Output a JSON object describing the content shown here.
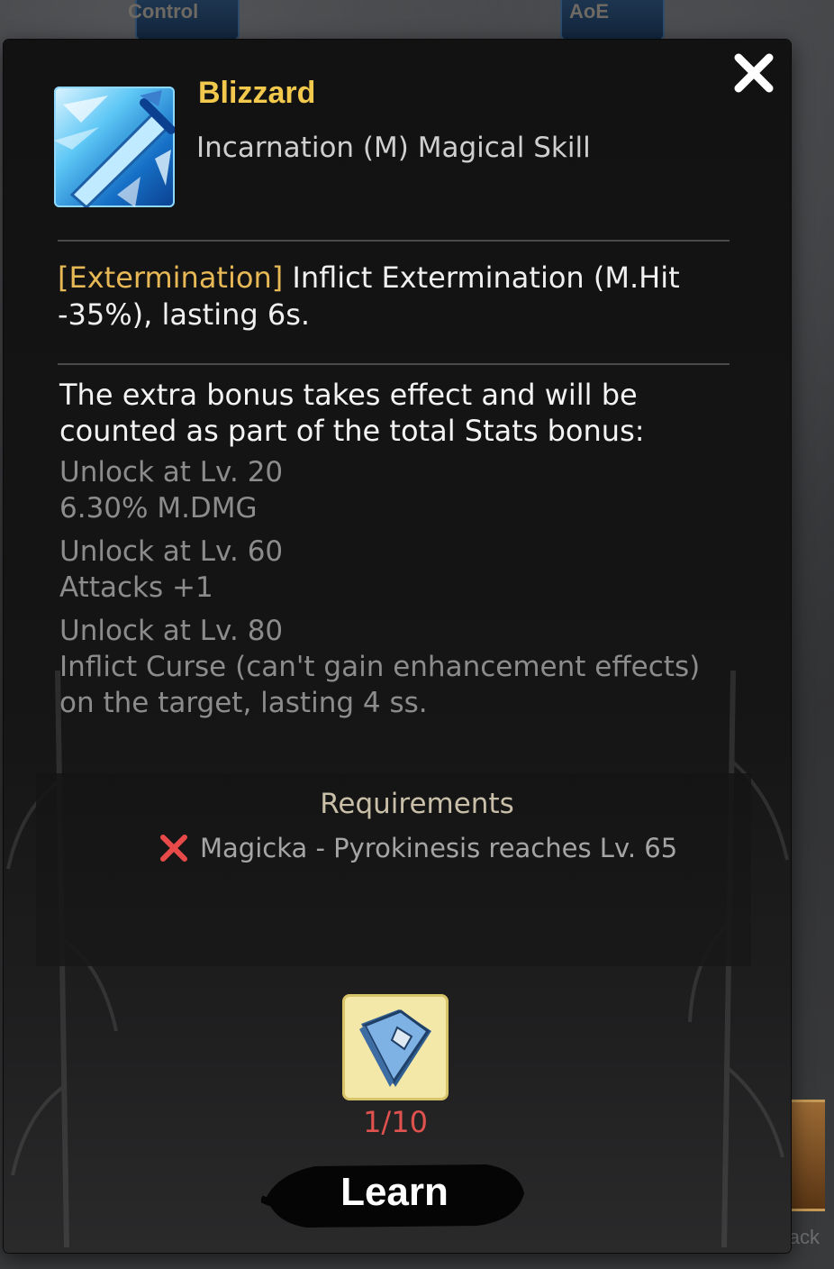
{
  "background": {
    "tabs": [
      "Control",
      "AoE"
    ],
    "right_text": "ack"
  },
  "skill": {
    "name": "Blizzard",
    "type": "Incarnation (M) Magical Skill",
    "icon": "ice-sword-icon"
  },
  "effect": {
    "tag": "[Extermination]",
    "text": " Inflict Extermination (M.Hit -35%), lasting 6s."
  },
  "bonus": {
    "intro": "The extra bonus takes effect and will be counted as part of the total Stats bonus:",
    "entries": [
      {
        "unlock": "Unlock at Lv. 20",
        "effect": "6.30% M.DMG"
      },
      {
        "unlock": "Unlock at Lv. 60",
        "effect": "Attacks +1"
      },
      {
        "unlock": "Unlock at Lv. 80",
        "effect": "Inflict Curse (can't gain enhancement effects) on the target, lasting 4 ss."
      }
    ]
  },
  "requirements": {
    "title": "Requirements",
    "items": [
      {
        "text": "Magicka - Pyrokinesis reaches Lv. 65",
        "met": false,
        "icon": "red-x-icon"
      }
    ]
  },
  "cost": {
    "icon": "skill-book-icon",
    "count": "1/10"
  },
  "learn_button": {
    "label": "Learn"
  },
  "close_icon": "close-icon",
  "colors": {
    "title": "#f2c94c",
    "tag": "#e7b856",
    "count": "#e0524e",
    "req_x": "#e84a4a"
  }
}
